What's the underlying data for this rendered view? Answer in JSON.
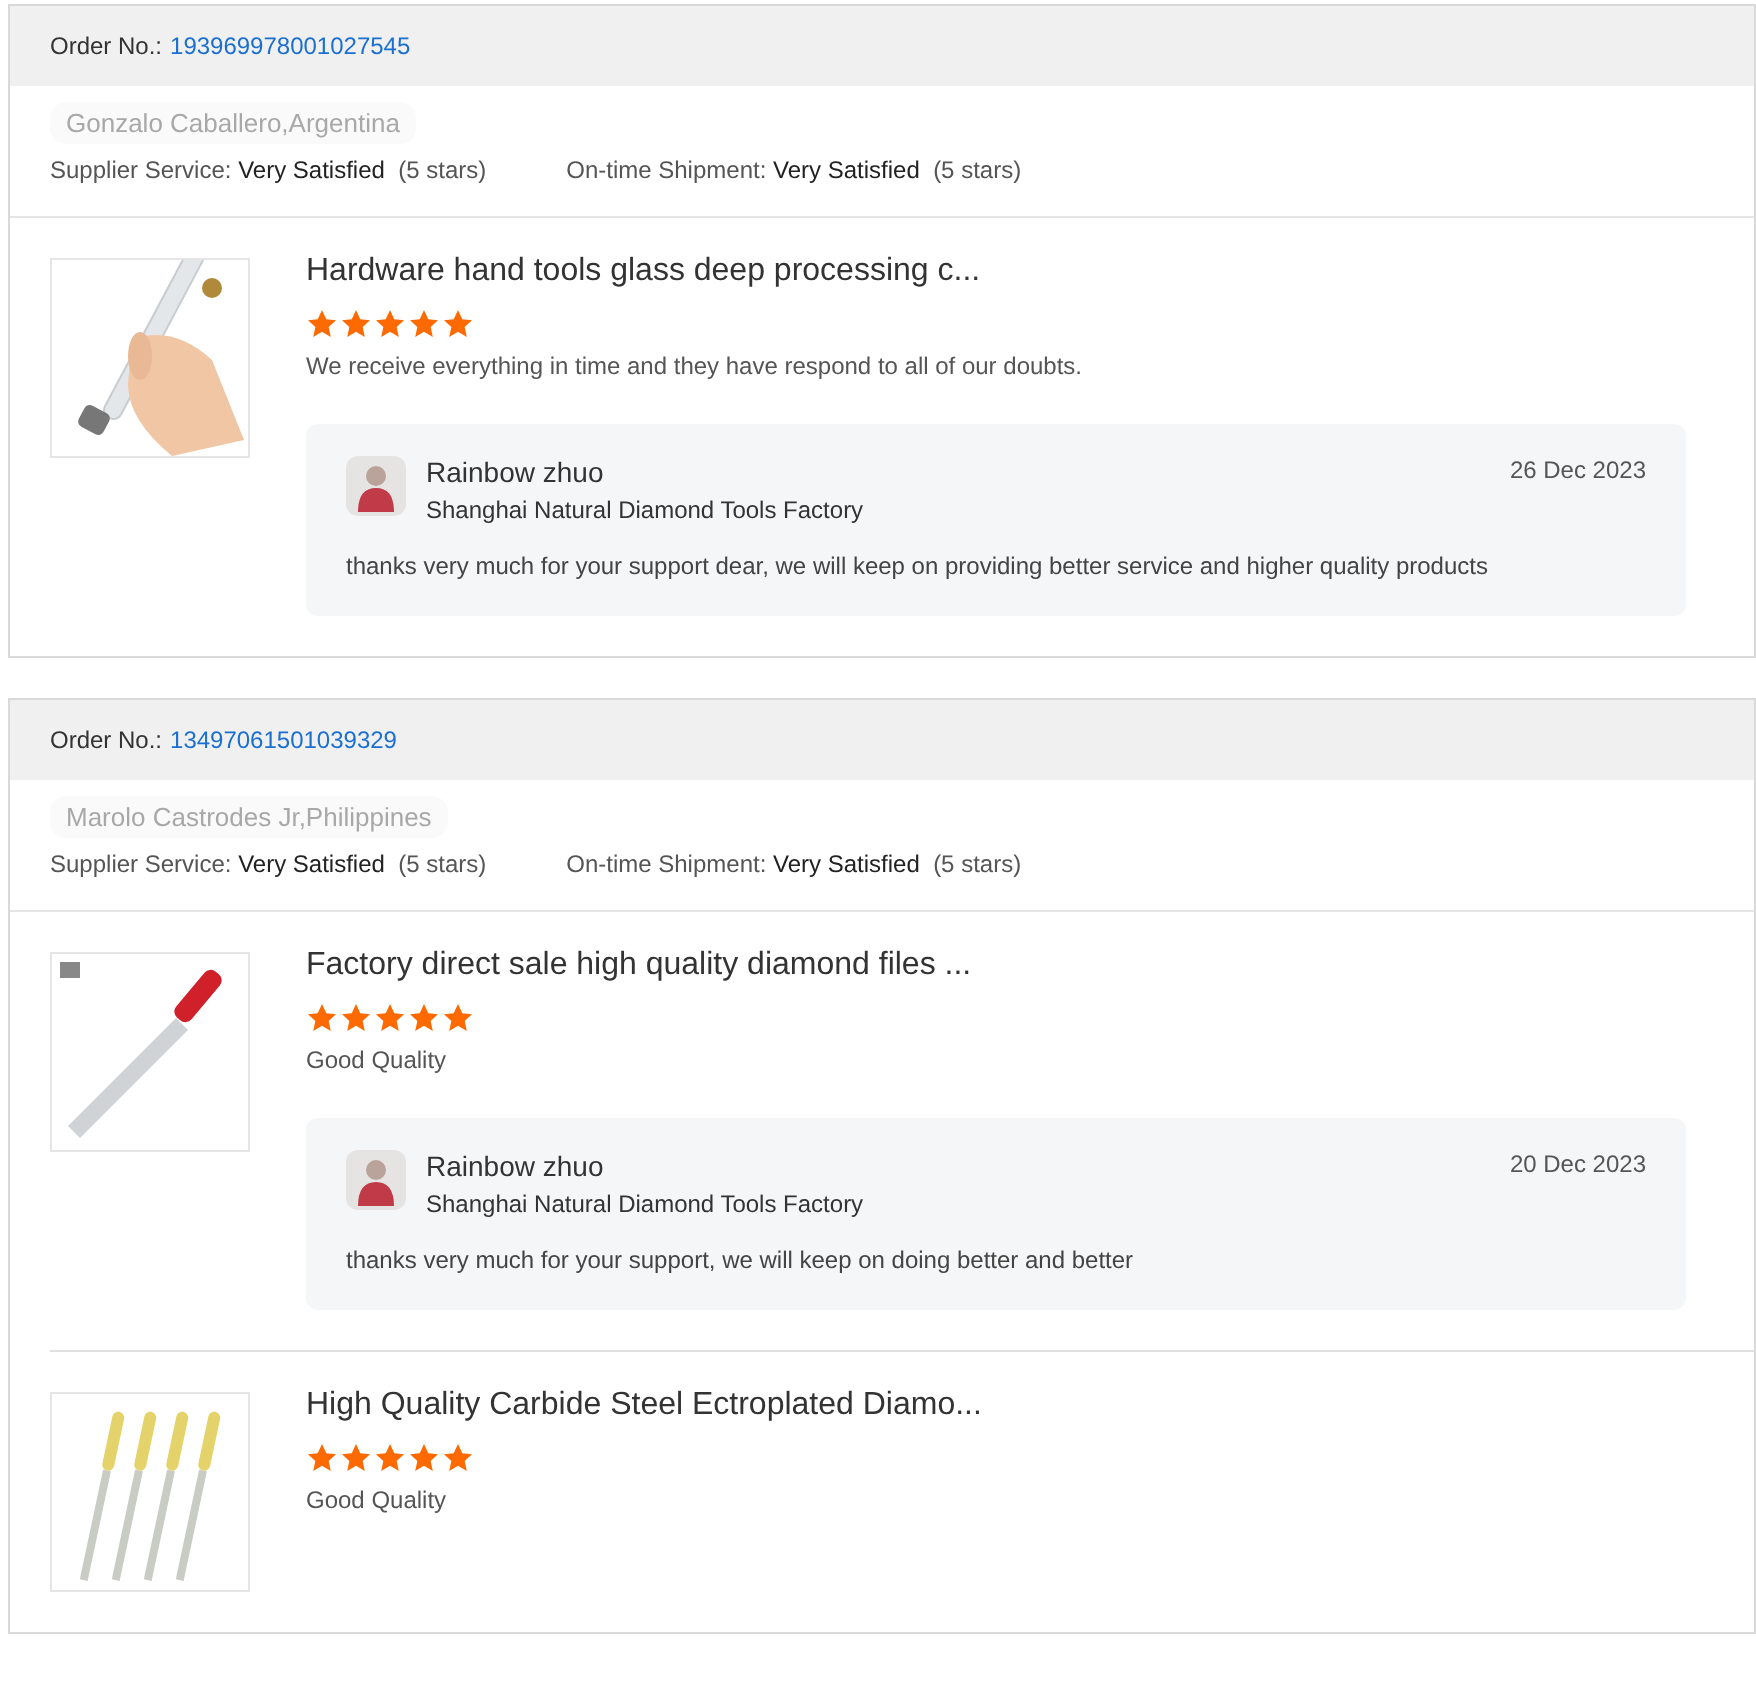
{
  "orders": [
    {
      "order_label": "Order No.:",
      "order_number": "193969978001027545",
      "buyer": "Gonzalo Caballero,Argentina",
      "ratings": [
        {
          "label": "Supplier Service:",
          "value": "Very Satisfied",
          "stars_text": "(5 stars)"
        },
        {
          "label": "On-time Shipment:",
          "value": "Very Satisfied",
          "stars_text": "(5 stars)"
        }
      ],
      "products": [
        {
          "kind": "cutter",
          "title": "Hardware hand tools glass deep processing c...",
          "stars": 5,
          "review": "We receive everything in time and they have respond to all of our doubts.",
          "reply": {
            "name": "Rainbow zhuo",
            "company": "Shanghai Natural Diamond Tools Factory",
            "date": "26 Dec 2023",
            "text": "thanks very much for your support dear, we will keep on providing  better service and higher quality products"
          }
        }
      ]
    },
    {
      "order_label": "Order No.:",
      "order_number": "13497061501039329",
      "buyer": "Marolo Castrodes Jr,Philippines",
      "ratings": [
        {
          "label": "Supplier Service:",
          "value": "Very Satisfied",
          "stars_text": "(5 stars)"
        },
        {
          "label": "On-time Shipment:",
          "value": "Very Satisfied",
          "stars_text": "(5 stars)"
        }
      ],
      "products": [
        {
          "kind": "file",
          "title": "Factory direct sale high quality diamond files ...",
          "stars": 5,
          "review": "Good Quality",
          "reply": {
            "name": "Rainbow zhuo",
            "company": "Shanghai Natural Diamond Tools Factory",
            "date": "20 Dec 2023",
            "text": "thanks very much for your support, we will keep on doing better and better"
          }
        },
        {
          "kind": "needles",
          "title": "High Quality Carbide Steel Ectroplated Diamo...",
          "stars": 5,
          "review": "Good Quality"
        }
      ]
    }
  ]
}
